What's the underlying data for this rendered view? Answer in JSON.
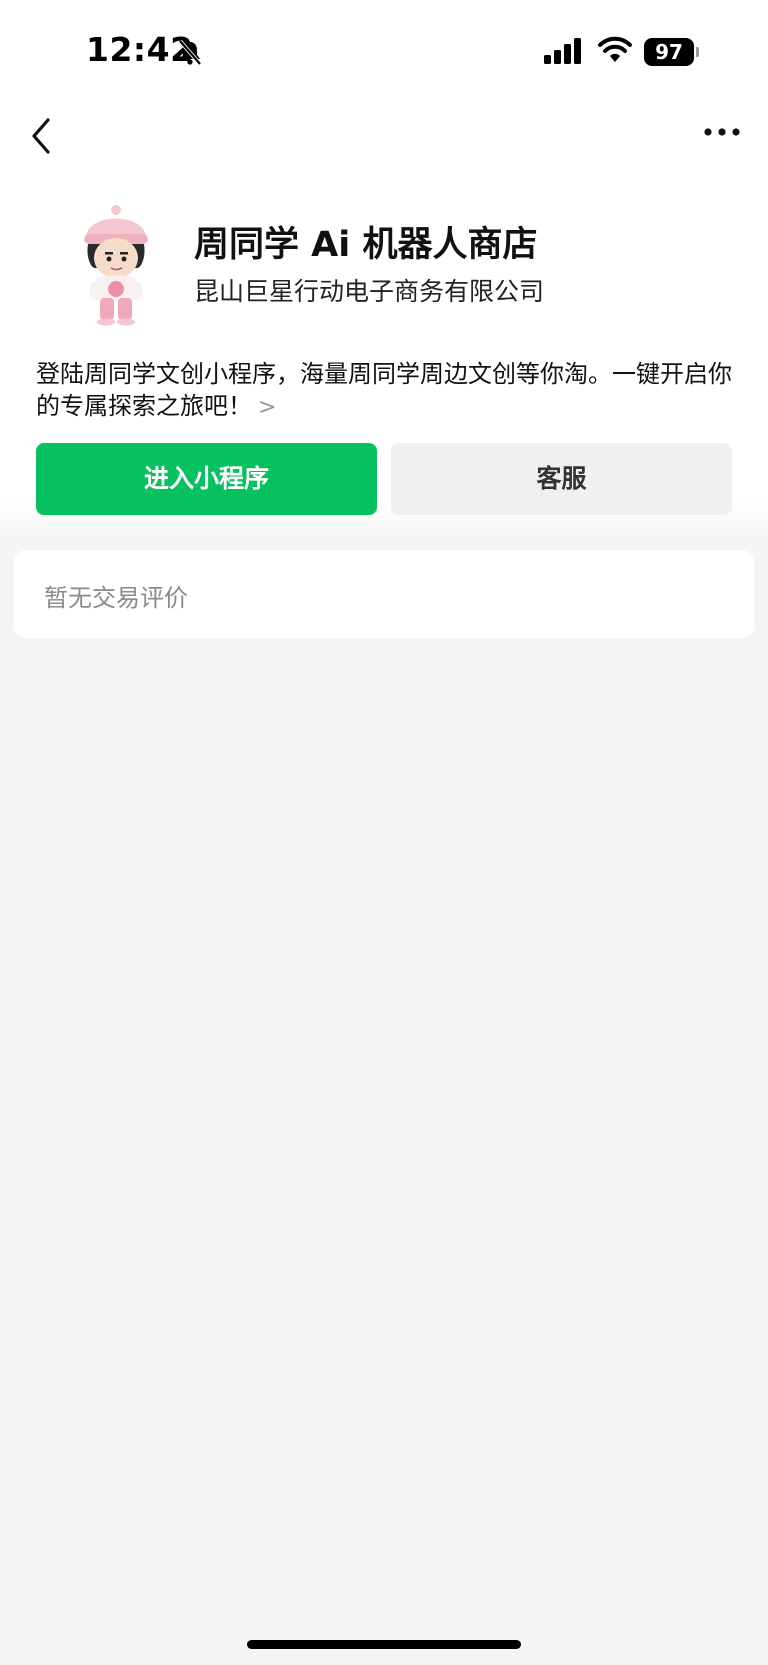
{
  "status_bar": {
    "time": "12:42",
    "battery": "97",
    "icons": [
      "bell-slash-icon",
      "signal-icon",
      "wifi-icon",
      "battery-icon"
    ]
  },
  "nav": {
    "back_icon": "chevron-left-icon",
    "more_icon": "more-dots-icon"
  },
  "shop": {
    "title": "周同学 Ai 机器人商店",
    "company": "昆山巨星行动电子商务有限公司",
    "description": "登陆周同学文创小程序，海量周同学周边文创等你淘。一键开启你的专属探索之旅吧！",
    "description_more_icon": "chevron-right-icon"
  },
  "actions": {
    "enter_label": "进入小程序",
    "service_label": "客服"
  },
  "reviews": {
    "empty_text": "暂无交易评价"
  },
  "colors": {
    "accent_green": "#07c160",
    "page_background": "#f5f5f5"
  }
}
